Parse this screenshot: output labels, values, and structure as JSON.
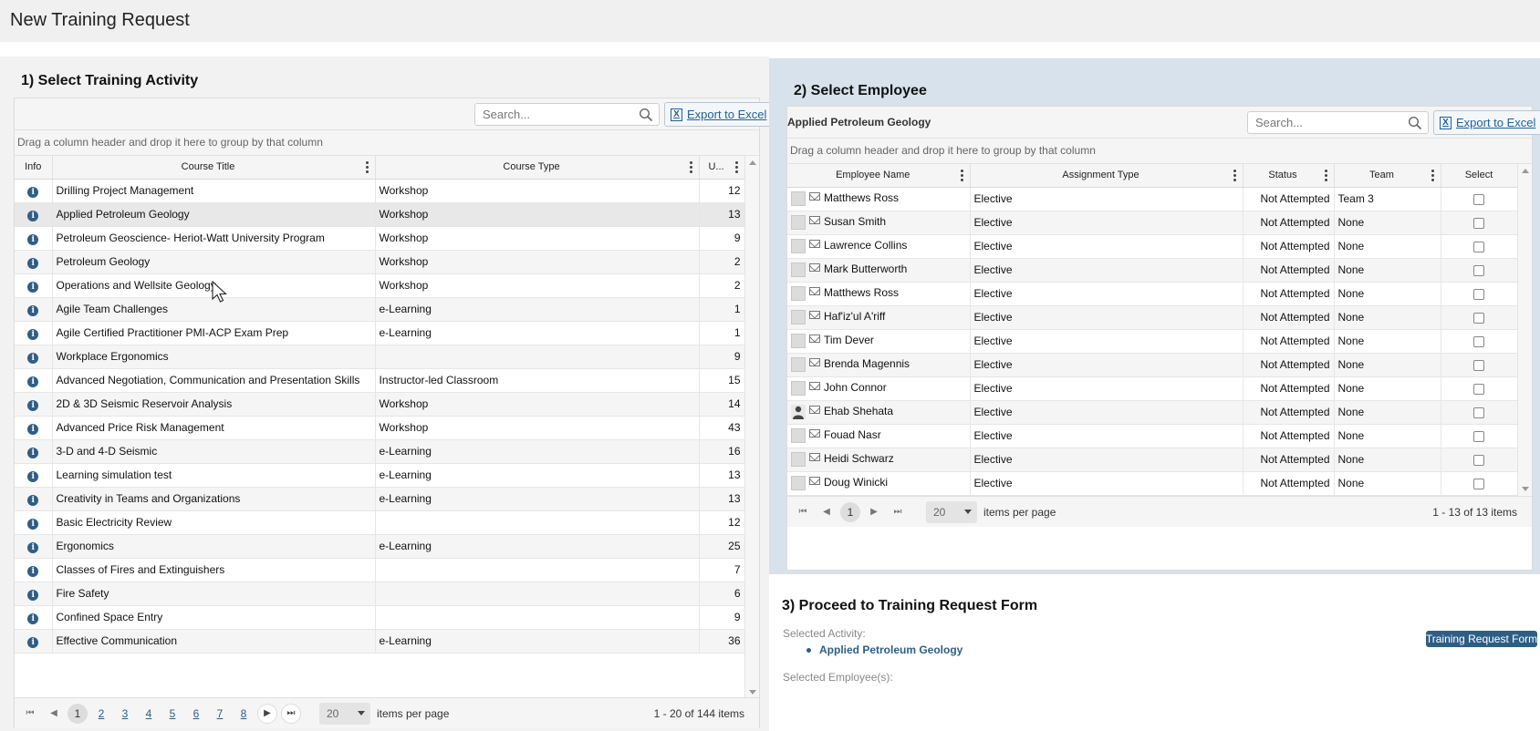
{
  "page": {
    "title": "New Training Request"
  },
  "step1": {
    "title": "1) Select Training Activity",
    "search_placeholder": "Search...",
    "export_label": "Export to Excel",
    "group_hint": "Drag a column header and drop it here to group by that column",
    "columns": [
      "Info",
      "Course Title",
      "Course Type",
      "U..."
    ],
    "rows": [
      {
        "title": "Drilling Project Management",
        "type": "Workshop",
        "u": "12"
      },
      {
        "title": "Applied Petroleum Geology",
        "type": "Workshop",
        "u": "13"
      },
      {
        "title": "Petroleum Geoscience- Heriot-Watt University Program",
        "type": "Workshop",
        "u": "9"
      },
      {
        "title": "Petroleum Geology",
        "type": "Workshop",
        "u": "2"
      },
      {
        "title": "Operations and Wellsite Geology",
        "type": "Workshop",
        "u": "2"
      },
      {
        "title": "Agile Team Challenges",
        "type": "e-Learning",
        "u": "1"
      },
      {
        "title": "Agile Certified Practitioner PMI-ACP Exam Prep",
        "type": "e-Learning",
        "u": "1"
      },
      {
        "title": "Workplace Ergonomics",
        "type": "",
        "u": "9"
      },
      {
        "title": "Advanced Negotiation, Communication and Presentation Skills",
        "type": "Instructor-led Classroom",
        "u": "15"
      },
      {
        "title": "2D & 3D Seismic Reservoir Analysis",
        "type": "Workshop",
        "u": "14"
      },
      {
        "title": "Advanced Price Risk Management",
        "type": "Workshop",
        "u": "43"
      },
      {
        "title": "3-D and 4-D Seismic",
        "type": "e-Learning",
        "u": "16"
      },
      {
        "title": "Learning simulation test",
        "type": "e-Learning",
        "u": "13"
      },
      {
        "title": "Creativity in Teams and Organizations",
        "type": "e-Learning",
        "u": "13"
      },
      {
        "title": "Basic Electricity Review",
        "type": "",
        "u": "12"
      },
      {
        "title": "Ergonomics",
        "type": "e-Learning",
        "u": "25"
      },
      {
        "title": "Classes of Fires and Extinguishers",
        "type": "",
        "u": "7"
      },
      {
        "title": "Fire Safety",
        "type": "",
        "u": "6"
      },
      {
        "title": "Confined Space Entry",
        "type": "",
        "u": "9"
      },
      {
        "title": "Effective Communication",
        "type": "e-Learning",
        "u": "36"
      }
    ],
    "pager": {
      "pages": [
        "1",
        "2",
        "3",
        "4",
        "5",
        "6",
        "7",
        "8"
      ],
      "page_size": "20",
      "items_per_page": "items per page",
      "info": "1 - 20 of 144 items"
    }
  },
  "step2": {
    "title": "2) Select Employee",
    "activity": "Applied Petroleum Geology",
    "search_placeholder": "Search...",
    "export_label": "Export to Excel",
    "group_hint": "Drag a column header and drop it here to group by that column",
    "columns": [
      "Employee Name",
      "Assignment Type",
      "Status",
      "Team",
      "Select"
    ],
    "rows": [
      {
        "name": "Matthews Ross",
        "type": "Elective",
        "status": "Not Attempted",
        "team": "Team 3"
      },
      {
        "name": "Susan Smith",
        "type": "Elective",
        "status": "Not Attempted",
        "team": "None"
      },
      {
        "name": "Lawrence Collins",
        "type": "Elective",
        "status": "Not Attempted",
        "team": "None"
      },
      {
        "name": "Mark Butterworth",
        "type": "Elective",
        "status": "Not Attempted",
        "team": "None"
      },
      {
        "name": "Matthews Ross",
        "type": "Elective",
        "status": "Not Attempted",
        "team": "None"
      },
      {
        "name": "Haf'iz'ul A'riff",
        "type": "Elective",
        "status": "Not Attempted",
        "team": "None"
      },
      {
        "name": "Tim Dever",
        "type": "Elective",
        "status": "Not Attempted",
        "team": "None"
      },
      {
        "name": "Brenda Magennis",
        "type": "Elective",
        "status": "Not Attempted",
        "team": "None"
      },
      {
        "name": "John Connor",
        "type": "Elective",
        "status": "Not Attempted",
        "team": "None"
      },
      {
        "name": "Ehab Shehata",
        "type": "Elective",
        "status": "Not Attempted",
        "team": "None"
      },
      {
        "name": "Fouad Nasr",
        "type": "Elective",
        "status": "Not Attempted",
        "team": "None"
      },
      {
        "name": "Heidi Schwarz",
        "type": "Elective",
        "status": "Not Attempted",
        "team": "None"
      },
      {
        "name": "Doug Winicki",
        "type": "Elective",
        "status": "Not Attempted",
        "team": "None"
      }
    ],
    "pager": {
      "current": "1",
      "page_size": "20",
      "items_per_page": "items per page",
      "info": "1 - 13 of 13 items"
    }
  },
  "step3": {
    "title": "3) Proceed to Training Request Form",
    "selected_activity_label": "Selected Activity:",
    "selected_activity": "Applied Petroleum Geology",
    "selected_employees_label": "Selected Employee(s):",
    "form_button": "Training Request Form"
  },
  "icons": {
    "info": "info-icon",
    "search": "search-icon",
    "excel": "excel-icon",
    "mail": "mail-icon",
    "avatar": "avatar-icon",
    "kebab": "column-menu-icon"
  },
  "colors": {
    "accent": "#2f5e85",
    "link": "#1f5f9b",
    "right_panel_bg": "#d7e2ec"
  }
}
